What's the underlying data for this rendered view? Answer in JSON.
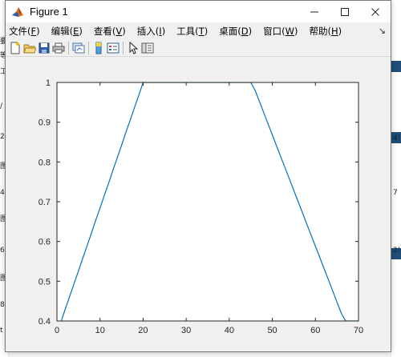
{
  "window": {
    "title": "Figure 1",
    "minimize_glyph": "—",
    "maximize_glyph": "☐",
    "close_glyph": "✕"
  },
  "menu": {
    "items": [
      {
        "label": "文件(",
        "hotkey": "F",
        "tail": ")"
      },
      {
        "label": "编辑(",
        "hotkey": "E",
        "tail": ")"
      },
      {
        "label": "查看(",
        "hotkey": "V",
        "tail": ")"
      },
      {
        "label": "插入(",
        "hotkey": "I",
        "tail": ")"
      },
      {
        "label": "工具(",
        "hotkey": "T",
        "tail": ")"
      },
      {
        "label": "桌面(",
        "hotkey": "D",
        "tail": ")"
      },
      {
        "label": "窗口(",
        "hotkey": "W",
        "tail": ")"
      },
      {
        "label": "帮助(",
        "hotkey": "H",
        "tail": ")"
      }
    ],
    "overflow_glyph": "↘"
  },
  "toolbar": {
    "icons": [
      "new-figure-icon",
      "open-file-icon",
      "save-icon",
      "print-icon",
      "link-plot-icon",
      "insert-colorbar-icon",
      "insert-legend-icon",
      "edit-plot-icon",
      "property-inspector-icon"
    ]
  },
  "background": {
    "left_fragments": [
      "要",
      "等",
      "工",
      "∕",
      "2",
      "图",
      "4",
      "图",
      "6",
      "图",
      "8",
      "t"
    ],
    "right_fragments": [
      "4!",
      "7",
      "2!"
    ]
  },
  "chart_data": {
    "type": "line",
    "title": "",
    "xlabel": "",
    "ylabel": "",
    "xlim": [
      0,
      70
    ],
    "ylim": [
      0.4,
      1.0
    ],
    "x_ticks": [
      "0",
      "10",
      "20",
      "30",
      "40",
      "50",
      "60",
      "70"
    ],
    "y_ticks": [
      "0.4",
      "0.5",
      "0.6",
      "0.7",
      "0.8",
      "0.9",
      "1"
    ],
    "grid": false,
    "series": [
      {
        "color": "#0072bd",
        "x": [
          1,
          2,
          3,
          4,
          5,
          6,
          7,
          8,
          9,
          10,
          11,
          12,
          13,
          14,
          15,
          16,
          17,
          18,
          19,
          20,
          21,
          25,
          30,
          35,
          40,
          44,
          45,
          46,
          47,
          48,
          49,
          50,
          51,
          52,
          53,
          54,
          55,
          56,
          57,
          58,
          59,
          60,
          61,
          62,
          63,
          64,
          65,
          66,
          67,
          68,
          69,
          70
        ],
        "y": [
          0.4,
          0.432,
          0.463,
          0.495,
          0.526,
          0.558,
          0.589,
          0.621,
          0.653,
          0.684,
          0.716,
          0.747,
          0.779,
          0.811,
          0.842,
          0.874,
          0.905,
          0.937,
          0.968,
          1.0,
          1.0,
          1.0,
          1.0,
          1.0,
          1.0,
          1.0,
          1.0,
          0.98,
          0.952,
          0.924,
          0.896,
          0.868,
          0.84,
          0.812,
          0.784,
          0.756,
          0.728,
          0.7,
          0.672,
          0.644,
          0.616,
          0.588,
          0.56,
          0.532,
          0.504,
          0.476,
          0.448,
          0.42,
          0.4,
          0.4,
          0.4,
          0.4
        ]
      }
    ]
  }
}
